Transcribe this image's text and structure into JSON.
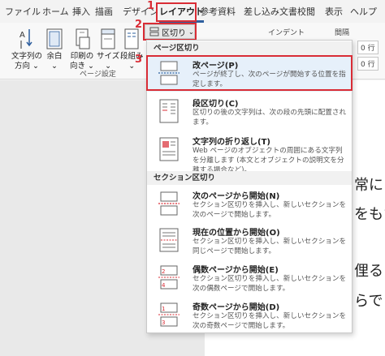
{
  "tabs": [
    {
      "label": "ファイル"
    },
    {
      "label": "ホーム"
    },
    {
      "label": "挿入"
    },
    {
      "label": "描画"
    },
    {
      "label": "デザイン"
    },
    {
      "label": "レイアウト"
    },
    {
      "label": "参考資料"
    },
    {
      "label": "差し込み文書"
    },
    {
      "label": "校閲"
    },
    {
      "label": "表示"
    },
    {
      "label": "ヘルプ"
    }
  ],
  "steps": [
    "1",
    "2",
    "3"
  ],
  "ribbon": {
    "buttons": [
      {
        "label": "文字列の\n方向 ⌄",
        "icon": "text-direction-icon"
      },
      {
        "label": "余白\n⌄",
        "icon": "margins-icon"
      },
      {
        "label": "印刷の\n向き ⌄",
        "icon": "orientation-icon"
      },
      {
        "label": "サイズ\n⌄",
        "icon": "size-icon"
      },
      {
        "label": "段組み\n⌄",
        "icon": "columns-icon"
      }
    ],
    "breaks_label": "区切り",
    "group_label": "ページ設定",
    "indent_label": "インデント",
    "spacing_label": "間隔",
    "spacing_before": "0 行",
    "spacing_after": "0 行"
  },
  "menu": {
    "page_breaks_header": "ページ区切り",
    "section_breaks_header": "セクション区切り",
    "page_items": [
      {
        "title": "改ページ(P)",
        "desc": "ページが終了し、次のページが開始する位置を指定します。",
        "icon": "page-break-icon"
      },
      {
        "title": "段区切り(C)",
        "desc": "区切りの後の文字列は、次の段の先頭に配置されます。",
        "icon": "column-break-icon"
      },
      {
        "title": "文字列の折り返し(T)",
        "desc": "Web ページのオブジェクトの周囲にある文字列を分離します (本文とオブジェクトの説明文を分離する場合など)。",
        "icon": "text-wrapping-icon"
      }
    ],
    "section_items": [
      {
        "title": "次のページから開始(N)",
        "desc": "セクション区切りを挿入し、新しいセクションを次のページで開始します。",
        "icon": "next-page-icon"
      },
      {
        "title": "現在の位置から開始(O)",
        "desc": "セクション区切りを挿入し、新しいセクションを同じページで開始します。",
        "icon": "continuous-icon"
      },
      {
        "title": "偶数ページから開始(E)",
        "desc": "セクション区切りを挿入し、新しいセクションを次の偶数ページで開始します。",
        "icon": "even-page-icon"
      },
      {
        "title": "奇数ページから開始(D)",
        "desc": "セクション区切りを挿入し、新しいセクションを次の奇数ページで開始します。",
        "icon": "odd-page-icon"
      }
    ]
  },
  "document": {
    "lines": [
      "常に",
      "をもた",
      "俚る",
      "らで"
    ]
  },
  "colors": {
    "highlight": "#d92c35",
    "accent": "#2e5f9e"
  }
}
